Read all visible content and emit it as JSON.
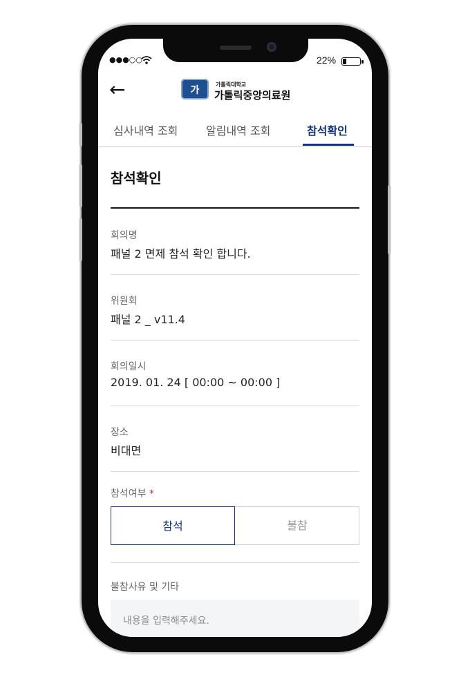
{
  "status_bar": {
    "signal": "●●●○○",
    "wifi_icon": "wifi-icon",
    "battery_percent": "22%",
    "battery_level": 0.22
  },
  "header": {
    "back_icon": "←",
    "logo_emblem": "가",
    "logo_subtitle": "가톨릭대학교",
    "logo_title": "가톨릭중앙의료원"
  },
  "tabs": [
    {
      "label": "심사내역 조회",
      "active": false
    },
    {
      "label": "알림내역 조회",
      "active": false
    },
    {
      "label": "참석확인",
      "active": true
    }
  ],
  "page": {
    "title": "참석확인",
    "fields": [
      {
        "label": "회의명",
        "value": "패널 2 면제 참석 확인 합니다."
      },
      {
        "label": "위원회",
        "value": "패널 2 _ v11.4"
      },
      {
        "label": "회의일시",
        "value": "2019. 01. 24  [ 00:00 ~ 00:00 ]"
      },
      {
        "label": "장소",
        "value": "비대면"
      }
    ],
    "attendance": {
      "label": "참석여부",
      "required_mark": "*",
      "options": [
        "참석",
        "불참"
      ],
      "selected": "참석"
    },
    "reason": {
      "label": "불참사유 및 기타",
      "placeholder": "내용을 입력해주세요.",
      "value": ""
    }
  },
  "colors": {
    "accent": "#12327e",
    "required": "#d0342c",
    "logo_blue": "#1d4f91"
  }
}
